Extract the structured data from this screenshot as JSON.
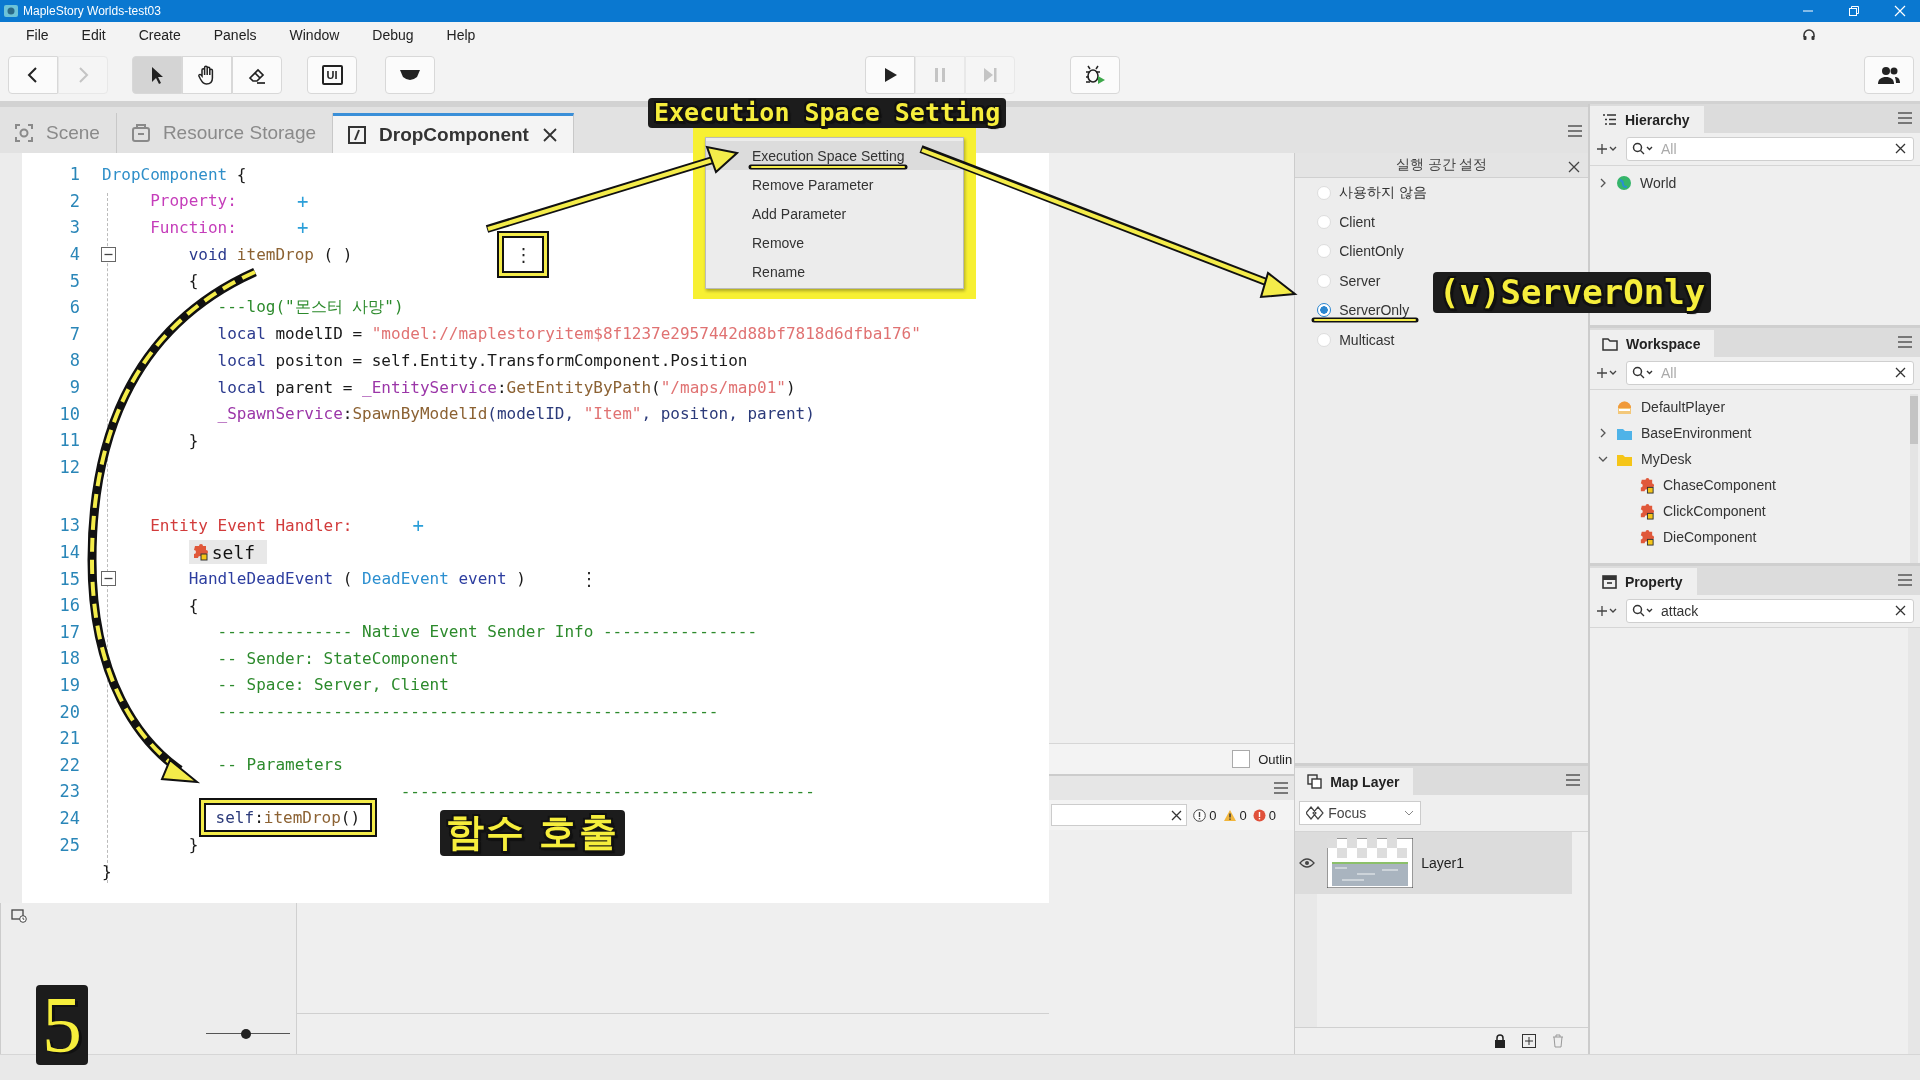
{
  "window": {
    "title": "MapleStory Worlds-test03"
  },
  "menu": [
    "File",
    "Edit",
    "Create",
    "Panels",
    "Window",
    "Debug",
    "Help"
  ],
  "toolbar": [
    {
      "buttons": [
        {
          "kind": "back",
          "disabled": false
        },
        {
          "kind": "forward",
          "disabled": true
        }
      ]
    },
    {
      "buttons": [
        {
          "kind": "select",
          "selected": true,
          "disabled": false
        },
        {
          "kind": "hand",
          "selected": false,
          "disabled": false
        },
        {
          "kind": "eraser",
          "selected": false,
          "disabled": false
        }
      ]
    },
    {
      "buttons": [
        {
          "kind": "ui",
          "label": "UI",
          "disabled": false
        }
      ]
    },
    {
      "buttons": [
        {
          "kind": "shape",
          "disabled": false
        }
      ]
    },
    {
      "buttons": [
        {
          "kind": "play",
          "disabled": false
        },
        {
          "kind": "pause",
          "disabled": true
        },
        {
          "kind": "step",
          "disabled": true
        }
      ]
    },
    {
      "buttons": [
        {
          "kind": "debug",
          "disabled": false
        }
      ]
    },
    {
      "buttons": [
        {
          "kind": "people",
          "disabled": false
        }
      ]
    }
  ],
  "tabs": [
    {
      "kind": "scene",
      "label": "Scene",
      "selected": false
    },
    {
      "kind": "storage",
      "label": "Resource Storage",
      "selected": false
    },
    {
      "kind": "script",
      "label": "DropComponent",
      "selected": true
    }
  ],
  "code": [
    {
      "number": "1",
      "tokens": [
        {
          "kind": "title",
          "text": "DropComponent"
        },
        {
          "kind": "plain",
          "text": " {"
        }
      ]
    },
    {
      "number": "2",
      "tokens": [
        {
          "kind": "section",
          "text": "     Property:"
        },
        {
          "kind": "plus",
          "text": "+"
        }
      ]
    },
    {
      "number": "3",
      "tokens": [
        {
          "kind": "section",
          "text": "     Function:"
        },
        {
          "kind": "plus",
          "text": "+"
        }
      ]
    },
    {
      "number": "4",
      "fold": true,
      "tokens": [
        {
          "kind": "keyword",
          "text": "         void"
        },
        {
          "kind": "func",
          "text": " itemDrop"
        },
        {
          "kind": "plain",
          "text": " ( )"
        },
        {
          "kind": "kebab",
          "text": "⋮",
          "boxed": true
        }
      ]
    },
    {
      "number": "5",
      "tokens": [
        {
          "kind": "plain",
          "text": "         {"
        }
      ]
    },
    {
      "number": "6",
      "tokens": [
        {
          "kind": "comment",
          "text": "            ---log(\"몬스터 사망\")"
        }
      ]
    },
    {
      "number": "7",
      "tokens": [
        {
          "kind": "keyword",
          "text": "            local"
        },
        {
          "kind": "plain",
          "text": " modelID = "
        },
        {
          "kind": "string",
          "text": "\"model://maplestoryitem$8f1237e2957442d88bf7818d6dfba176\""
        }
      ]
    },
    {
      "number": "8",
      "tokens": [
        {
          "kind": "keyword",
          "text": "            local"
        },
        {
          "kind": "plain",
          "text": " positon = self.Entity.TransformComponent.Position"
        }
      ]
    },
    {
      "number": "9",
      "tokens": [
        {
          "kind": "keyword",
          "text": "            local"
        },
        {
          "kind": "plain",
          "text": " parent = "
        },
        {
          "kind": "service",
          "text": "_EntityService"
        },
        {
          "kind": "plain",
          "text": ":"
        },
        {
          "kind": "func",
          "text": "GetEntityByPath"
        },
        {
          "kind": "plain",
          "text": "("
        },
        {
          "kind": "string",
          "text": "\"/maps/map01\""
        },
        {
          "kind": "plain",
          "text": ")"
        }
      ]
    },
    {
      "number": "10",
      "tokens": [
        {
          "kind": "service",
          "text": "            _SpawnService"
        },
        {
          "kind": "plain",
          "text": ":"
        },
        {
          "kind": "func",
          "text": "SpawnByModelId"
        },
        {
          "kind": "param",
          "text": "(modelID, "
        },
        {
          "kind": "string",
          "text": "\"Item\""
        },
        {
          "kind": "param",
          "text": ", positon, parent)"
        }
      ]
    },
    {
      "number": "11",
      "tokens": [
        {
          "kind": "plain",
          "text": "         }"
        }
      ]
    },
    {
      "number": "12"
    },
    {
      "number": "13",
      "tokens": [
        {
          "kind": "handler",
          "text": "     Entity Event Handler:"
        },
        {
          "kind": "plus",
          "text": "+"
        }
      ]
    },
    {
      "number": "14",
      "tokens": [
        {
          "kind": "chip",
          "text": "         self"
        }
      ]
    },
    {
      "number": "15",
      "fold": true,
      "tokens": [
        {
          "kind": "event",
          "text": "         HandleDeadEvent"
        },
        {
          "kind": "plain",
          "text": " ( "
        },
        {
          "kind": "type",
          "text": "DeadEvent"
        },
        {
          "kind": "event",
          "text": " event"
        },
        {
          "kind": "plain",
          "text": " )"
        },
        {
          "kind": "kebab",
          "text": "⋮",
          "boxed": false
        }
      ]
    },
    {
      "number": "16",
      "tokens": [
        {
          "kind": "plain",
          "text": "         {"
        }
      ]
    },
    {
      "number": "17",
      "tokens": [
        {
          "kind": "comment",
          "text": "            -------------- Native Event Sender Info ----------------"
        }
      ]
    },
    {
      "number": "18",
      "tokens": [
        {
          "kind": "comment",
          "text": "            -- Sender: StateComponent"
        }
      ]
    },
    {
      "number": "19",
      "tokens": [
        {
          "kind": "comment",
          "text": "            -- Space: Server, Client"
        }
      ]
    },
    {
      "number": "20",
      "tokens": [
        {
          "kind": "comment",
          "text": "            ----------------------------------------------------"
        }
      ]
    },
    {
      "number": "21"
    },
    {
      "number": "22",
      "tokens": [
        {
          "kind": "comment",
          "text": "            -- Parameters"
        }
      ]
    },
    {
      "number": "23",
      "tokens": [
        {
          "kind": "comment",
          "text": "                               -------------------------------------------"
        }
      ]
    },
    {
      "number": "24",
      "boxed": true,
      "tokens": [
        {
          "kind": "param",
          "text": "            self"
        },
        {
          "kind": "plain",
          "text": ":"
        },
        {
          "kind": "func",
          "text": "itemDrop"
        },
        {
          "kind": "plain",
          "text": "()"
        }
      ]
    },
    {
      "number": "25",
      "tokens": [
        {
          "kind": "plain",
          "text": "         }"
        }
      ]
    },
    {
      "tokens": [
        {
          "kind": "plain",
          "text": "}"
        }
      ]
    }
  ],
  "context_menu": [
    {
      "label": "Execution Space Setting",
      "selected": true
    },
    {
      "label": "Remove Parameter",
      "selected": false
    },
    {
      "label": "Add Parameter",
      "selected": false
    },
    {
      "label": "Remove",
      "selected": false
    },
    {
      "label": "Rename",
      "selected": false
    }
  ],
  "execution_space": {
    "title": "실행 공간 설정",
    "options": [
      {
        "label": "사용하지 않음",
        "selected": false
      },
      {
        "label": "Client",
        "selected": false
      },
      {
        "label": "ClientOnly",
        "selected": false
      },
      {
        "label": "Server",
        "selected": false
      },
      {
        "label": "ServerOnly",
        "selected": true
      },
      {
        "label": "Multicast",
        "selected": false
      }
    ]
  },
  "outline": {
    "label": "Outlin",
    "checked": false
  },
  "zoom_slider": {
    "level": 0.47
  },
  "console": {
    "counts": [
      {
        "kind": "info",
        "text": "0"
      },
      {
        "kind": "warning",
        "text": "0"
      },
      {
        "kind": "error",
        "text": "0"
      }
    ]
  },
  "map_layer": {
    "title": "Map Layer",
    "mode": "Focus",
    "layers": [
      {
        "name": "Layer1",
        "visible": true,
        "selected": true
      }
    ]
  },
  "hierarchy": {
    "title": "Hierarchy",
    "placeholder": "All",
    "items": [
      {
        "kind": "globe",
        "label": "World",
        "expanded": false
      }
    ]
  },
  "workspace": {
    "title": "Workspace",
    "placeholder": "All",
    "items": [
      {
        "kind": "player",
        "label": "DefaultPlayer"
      },
      {
        "kind": "folder",
        "color": "#4fb3e8",
        "label": "BaseEnvironment",
        "expanded": false
      },
      {
        "kind": "folder",
        "color": "#f5c518",
        "label": "MyDesk",
        "expanded": true,
        "children": [
          {
            "kind": "component",
            "label": "ChaseComponent"
          },
          {
            "kind": "component",
            "label": "ClickComponent"
          },
          {
            "kind": "component",
            "label": "DieComponent"
          }
        ]
      }
    ]
  },
  "property": {
    "title": "Property",
    "value": "attack"
  },
  "annotations": {
    "menu_caption": "Execution Space Setting",
    "result": "(v)ServerOnly",
    "call": "함수 호출",
    "page_number": "5"
  }
}
